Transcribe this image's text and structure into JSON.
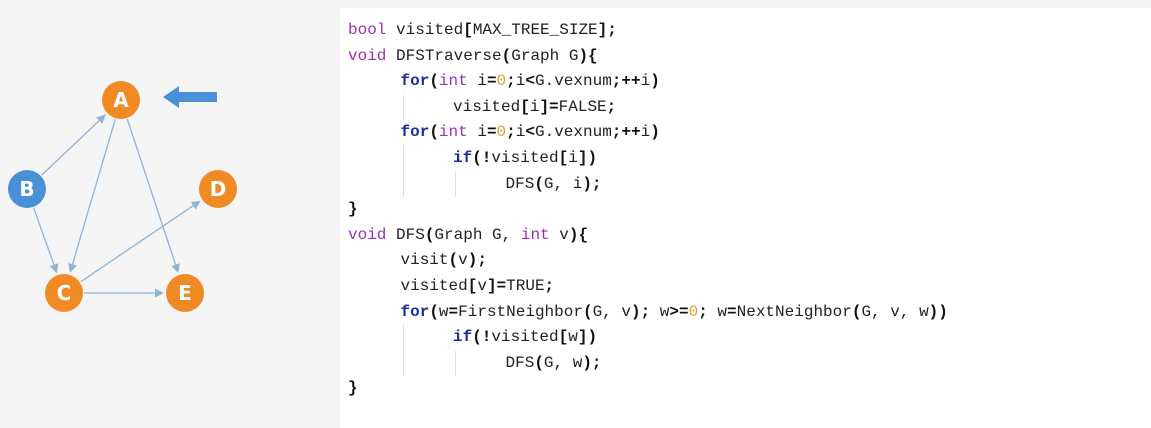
{
  "graph": {
    "nodes": [
      {
        "id": "A",
        "label": "A",
        "color": "#f08a24"
      },
      {
        "id": "B",
        "label": "B",
        "color": "#4a90d9"
      },
      {
        "id": "C",
        "label": "C",
        "color": "#f08a24"
      },
      {
        "id": "D",
        "label": "D",
        "color": "#f08a24"
      },
      {
        "id": "E",
        "label": "E",
        "color": "#f08a24"
      }
    ],
    "edges": [
      {
        "from": "B",
        "to": "A"
      },
      {
        "from": "B",
        "to": "C"
      },
      {
        "from": "A",
        "to": "C"
      },
      {
        "from": "A",
        "to": "E"
      },
      {
        "from": "C",
        "to": "D"
      },
      {
        "from": "C",
        "to": "E"
      }
    ],
    "edge_color": "#8fb4d9",
    "pointer": {
      "target": "A",
      "color": "#4a90d9",
      "icon": "left-arrow-icon"
    }
  },
  "code": {
    "lines": [
      {
        "indent": 0,
        "tokens": [
          [
            "type",
            "bool"
          ],
          [
            "plain",
            " visited"
          ],
          [
            "op",
            "["
          ],
          [
            "plain",
            "MAX_TREE_SIZE"
          ],
          [
            "op",
            "];"
          ]
        ]
      },
      {
        "indent": 0,
        "tokens": [
          [
            "type",
            "void"
          ],
          [
            "plain",
            " DFSTraverse"
          ],
          [
            "op",
            "("
          ],
          [
            "plain",
            "Graph G"
          ],
          [
            "op",
            "){"
          ]
        ]
      },
      {
        "indent": 1,
        "tokens": [
          [
            "ctrl",
            "for"
          ],
          [
            "op",
            "("
          ],
          [
            "type",
            "int"
          ],
          [
            "plain",
            " i"
          ],
          [
            "op",
            "="
          ],
          [
            "num",
            "0"
          ],
          [
            "op",
            ";"
          ],
          [
            "plain",
            "i"
          ],
          [
            "op",
            "<"
          ],
          [
            "plain",
            "G.vexnum"
          ],
          [
            "op",
            ";++"
          ],
          [
            "plain",
            "i"
          ],
          [
            "op",
            ")"
          ]
        ]
      },
      {
        "indent": 2,
        "tokens": [
          [
            "plain",
            "visited"
          ],
          [
            "op",
            "["
          ],
          [
            "plain",
            "i"
          ],
          [
            "op",
            "]="
          ],
          [
            "plain",
            "FALSE"
          ],
          [
            "op",
            ";"
          ]
        ]
      },
      {
        "indent": 1,
        "tokens": [
          [
            "ctrl",
            "for"
          ],
          [
            "op",
            "("
          ],
          [
            "type",
            "int"
          ],
          [
            "plain",
            " i"
          ],
          [
            "op",
            "="
          ],
          [
            "num",
            "0"
          ],
          [
            "op",
            ";"
          ],
          [
            "plain",
            "i"
          ],
          [
            "op",
            "<"
          ],
          [
            "plain",
            "G.vexnum"
          ],
          [
            "op",
            ";++"
          ],
          [
            "plain",
            "i"
          ],
          [
            "op",
            ")"
          ]
        ]
      },
      {
        "indent": 2,
        "tokens": [
          [
            "ctrl",
            "if"
          ],
          [
            "op",
            "(!"
          ],
          [
            "plain",
            "visited"
          ],
          [
            "op",
            "["
          ],
          [
            "plain",
            "i"
          ],
          [
            "op",
            "])"
          ]
        ]
      },
      {
        "indent": 3,
        "tokens": [
          [
            "plain",
            "DFS"
          ],
          [
            "op",
            "("
          ],
          [
            "plain",
            "G, i"
          ],
          [
            "op",
            ");"
          ]
        ]
      },
      {
        "indent": 0,
        "tokens": [
          [
            "op",
            "}"
          ]
        ]
      },
      {
        "indent": 0,
        "tokens": [
          [
            "type",
            "void"
          ],
          [
            "plain",
            " DFS"
          ],
          [
            "op",
            "("
          ],
          [
            "plain",
            "Graph G, "
          ],
          [
            "type",
            "int"
          ],
          [
            "plain",
            " v"
          ],
          [
            "op",
            "){"
          ]
        ]
      },
      {
        "indent": 1,
        "tokens": [
          [
            "plain",
            "visit"
          ],
          [
            "op",
            "("
          ],
          [
            "plain",
            "v"
          ],
          [
            "op",
            ");"
          ]
        ]
      },
      {
        "indent": 1,
        "tokens": [
          [
            "plain",
            "visited"
          ],
          [
            "op",
            "["
          ],
          [
            "plain",
            "v"
          ],
          [
            "op",
            "]="
          ],
          [
            "plain",
            "TRUE"
          ],
          [
            "op",
            ";"
          ]
        ]
      },
      {
        "indent": 1,
        "tokens": [
          [
            "ctrl",
            "for"
          ],
          [
            "op",
            "("
          ],
          [
            "plain",
            "w"
          ],
          [
            "op",
            "="
          ],
          [
            "plain",
            "FirstNeighbor"
          ],
          [
            "op",
            "("
          ],
          [
            "plain",
            "G, v"
          ],
          [
            "op",
            ");"
          ],
          [
            "plain",
            " w"
          ],
          [
            "op",
            ">="
          ],
          [
            "num",
            "0"
          ],
          [
            "op",
            ";"
          ],
          [
            "plain",
            " w"
          ],
          [
            "op",
            "="
          ],
          [
            "plain",
            "NextNeighbor"
          ],
          [
            "op",
            "("
          ],
          [
            "plain",
            "G, v, w"
          ],
          [
            "op",
            "))"
          ]
        ]
      },
      {
        "indent": 2,
        "tokens": [
          [
            "ctrl",
            "if"
          ],
          [
            "op",
            "(!"
          ],
          [
            "plain",
            "visited"
          ],
          [
            "op",
            "["
          ],
          [
            "plain",
            "w"
          ],
          [
            "op",
            "])"
          ]
        ]
      },
      {
        "indent": 3,
        "tokens": [
          [
            "plain",
            "DFS"
          ],
          [
            "op",
            "("
          ],
          [
            "plain",
            "G, w"
          ],
          [
            "op",
            ");"
          ]
        ]
      },
      {
        "indent": 0,
        "tokens": [
          [
            "op",
            "}"
          ]
        ]
      }
    ]
  }
}
